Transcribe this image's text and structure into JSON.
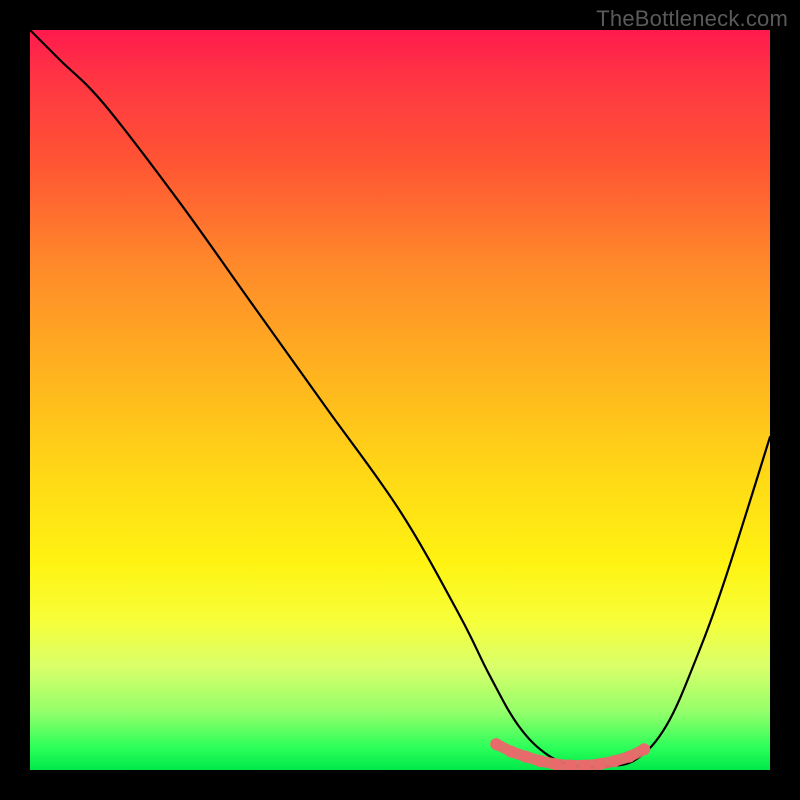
{
  "watermark": "TheBottleneck.com",
  "chart_data": {
    "type": "line",
    "title": "",
    "xlabel": "",
    "ylabel": "",
    "xlim": [
      0,
      100
    ],
    "ylim": [
      0,
      100
    ],
    "series": [
      {
        "name": "main-curve",
        "color": "#000000",
        "x": [
          0,
          4,
          10,
          20,
          30,
          40,
          50,
          58,
          62,
          66,
          70,
          74,
          78,
          82,
          86,
          90,
          94,
          100
        ],
        "y": [
          100,
          96,
          90,
          77,
          63,
          49,
          35,
          21,
          13,
          6,
          2,
          0.5,
          0.5,
          1.5,
          6,
          15,
          26,
          45
        ]
      },
      {
        "name": "highlight-dots",
        "color": "#e86a6a",
        "x": [
          63,
          65,
          67,
          69,
          71,
          73,
          75,
          77,
          79,
          81,
          83
        ],
        "y": [
          3.5,
          2.5,
          1.8,
          1.2,
          0.8,
          0.6,
          0.6,
          0.8,
          1.2,
          1.8,
          2.8
        ]
      }
    ],
    "gradient_stops": [
      {
        "pos": 0,
        "color": "#ff1a4d"
      },
      {
        "pos": 18,
        "color": "#ff5533"
      },
      {
        "pos": 46,
        "color": "#ffb21f"
      },
      {
        "pos": 72,
        "color": "#fff312"
      },
      {
        "pos": 92,
        "color": "#96ff6a"
      },
      {
        "pos": 100,
        "color": "#00e84a"
      }
    ]
  }
}
